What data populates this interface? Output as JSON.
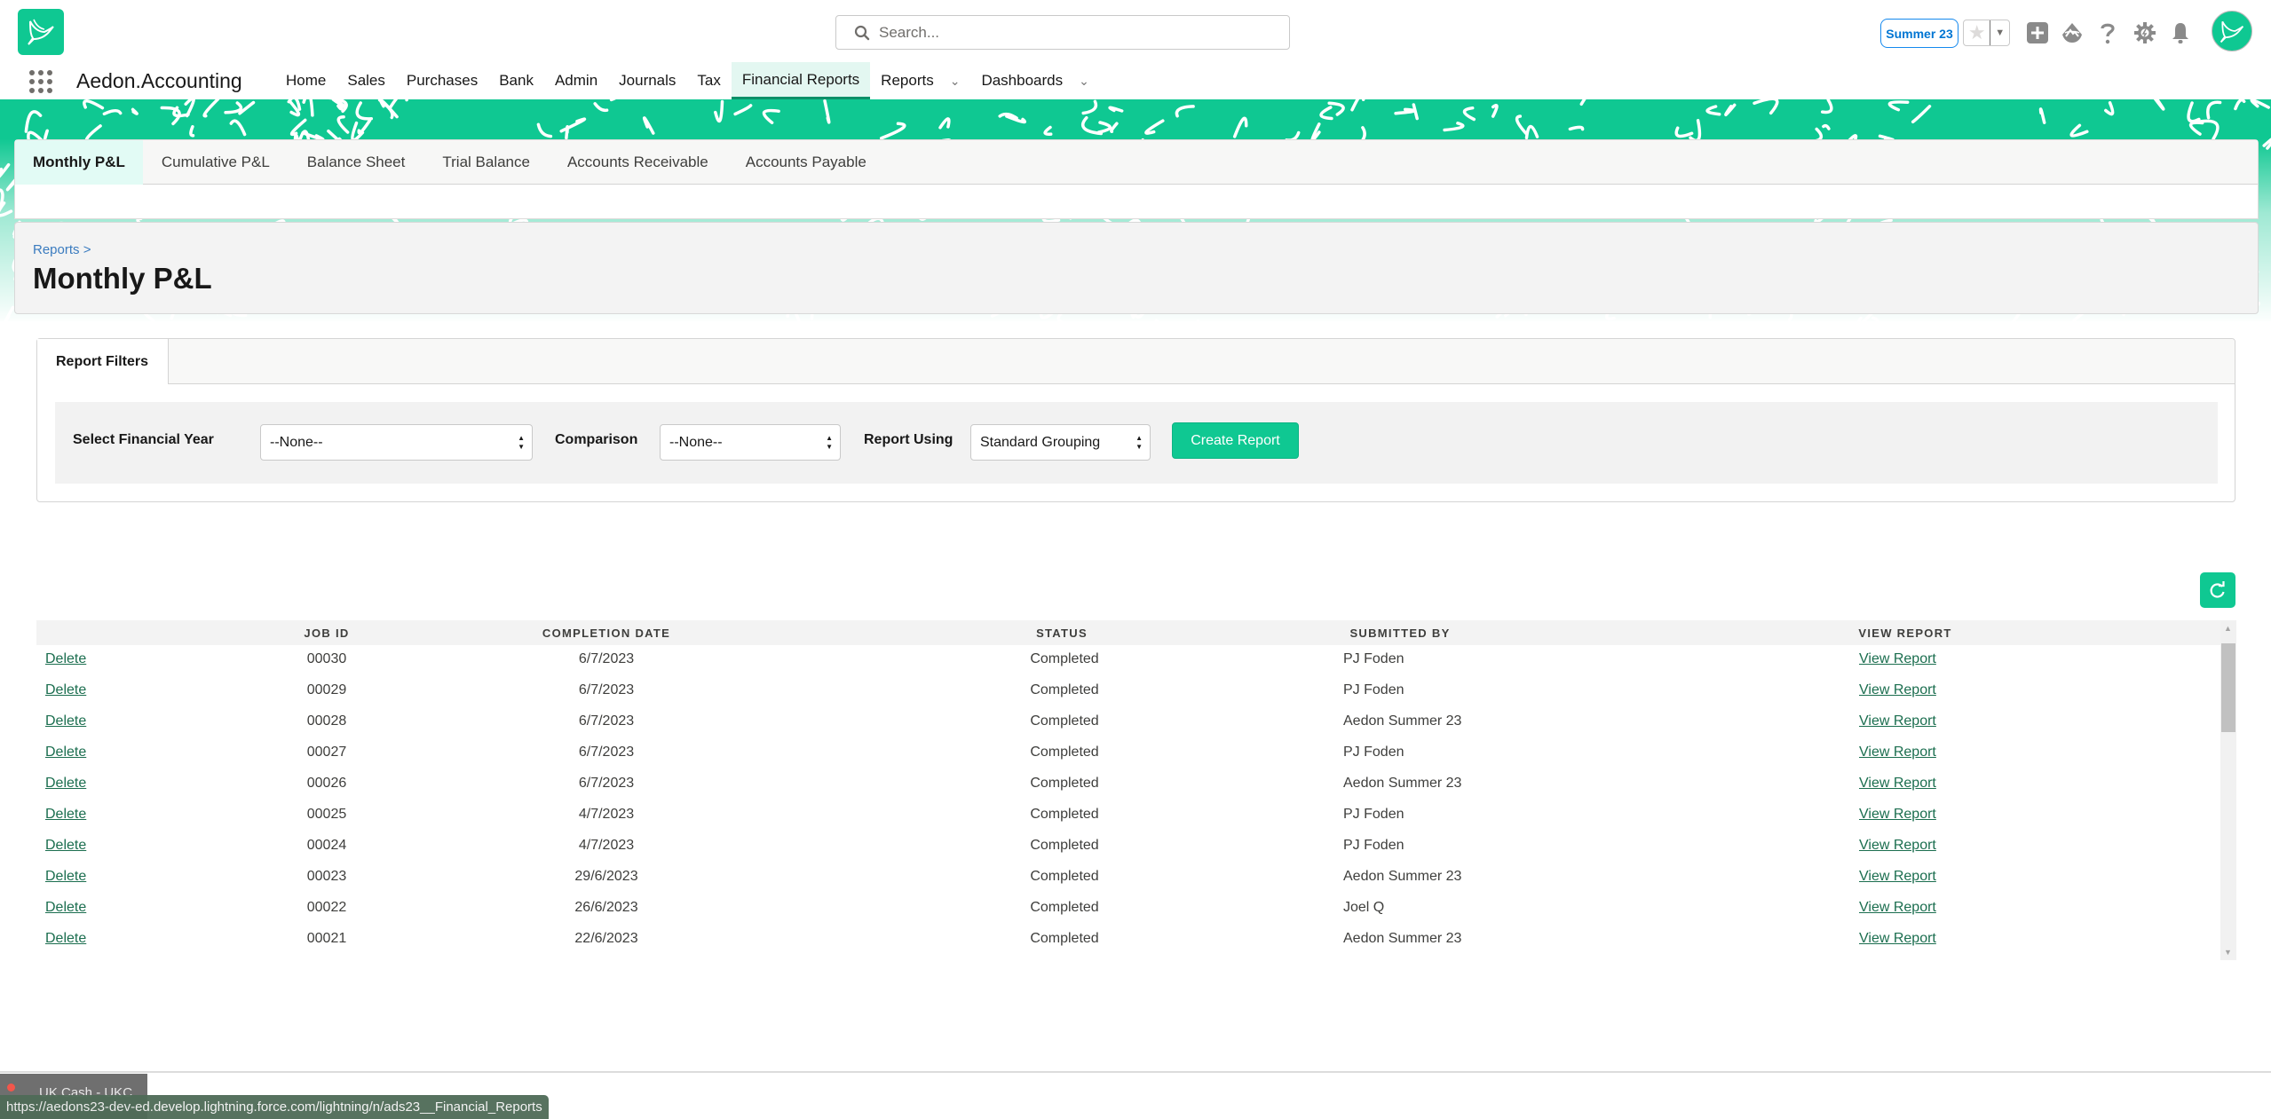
{
  "header": {
    "app_logo_icon": "hummingbird-logo-icon",
    "search_placeholder": "Search...",
    "org_badge": "Summer 23",
    "icons": [
      "favorite-star-icon",
      "favorites-dropdown-icon",
      "global-actions-plus-icon",
      "trailhead-icon",
      "help-icon",
      "setup-gear-icon",
      "notifications-bell-icon",
      "user-avatar-icon"
    ]
  },
  "nav": {
    "app_name": "Aedon.Accounting",
    "items": [
      {
        "label": "Home",
        "active": false,
        "has_menu": false
      },
      {
        "label": "Sales",
        "active": false,
        "has_menu": false
      },
      {
        "label": "Purchases",
        "active": false,
        "has_menu": false
      },
      {
        "label": "Bank",
        "active": false,
        "has_menu": false
      },
      {
        "label": "Admin",
        "active": false,
        "has_menu": false
      },
      {
        "label": "Journals",
        "active": false,
        "has_menu": false
      },
      {
        "label": "Tax",
        "active": false,
        "has_menu": false
      },
      {
        "label": "Financial Reports",
        "active": true,
        "has_menu": false
      },
      {
        "label": "Reports",
        "active": false,
        "has_menu": true
      },
      {
        "label": "Dashboards",
        "active": false,
        "has_menu": true
      }
    ]
  },
  "report_tabs": [
    {
      "label": "Monthly P&L",
      "active": true
    },
    {
      "label": "Cumulative P&L",
      "active": false
    },
    {
      "label": "Balance Sheet",
      "active": false
    },
    {
      "label": "Trial Balance",
      "active": false
    },
    {
      "label": "Accounts Receivable",
      "active": false
    },
    {
      "label": "Accounts Payable",
      "active": false
    }
  ],
  "page": {
    "breadcrumb": "Reports >",
    "title": "Monthly P&L"
  },
  "filters": {
    "tab_label": "Report Filters",
    "financial_year_label": "Select Financial Year",
    "financial_year_value": "--None--",
    "comparison_label": "Comparison",
    "comparison_value": "--None--",
    "report_using_label": "Report Using",
    "report_using_value": "Standard Grouping",
    "create_button": "Create Report"
  },
  "jobs_table": {
    "refresh_icon": "refresh-icon",
    "columns": [
      "",
      "JOB ID",
      "COMPLETION DATE",
      "STATUS",
      "SUBMITTED BY",
      "VIEW REPORT"
    ],
    "rows": [
      {
        "action": "Delete",
        "job_id": "00030",
        "completion_date": "6/7/2023",
        "status": "Completed",
        "submitted_by": "PJ Foden",
        "view": "View Report"
      },
      {
        "action": "Delete",
        "job_id": "00029",
        "completion_date": "6/7/2023",
        "status": "Completed",
        "submitted_by": "PJ Foden",
        "view": "View Report"
      },
      {
        "action": "Delete",
        "job_id": "00028",
        "completion_date": "6/7/2023",
        "status": "Completed",
        "submitted_by": "Aedon Summer 23",
        "view": "View Report"
      },
      {
        "action": "Delete",
        "job_id": "00027",
        "completion_date": "6/7/2023",
        "status": "Completed",
        "submitted_by": "PJ Foden",
        "view": "View Report"
      },
      {
        "action": "Delete",
        "job_id": "00026",
        "completion_date": "6/7/2023",
        "status": "Completed",
        "submitted_by": "Aedon Summer 23",
        "view": "View Report"
      },
      {
        "action": "Delete",
        "job_id": "00025",
        "completion_date": "4/7/2023",
        "status": "Completed",
        "submitted_by": "PJ Foden",
        "view": "View Report"
      },
      {
        "action": "Delete",
        "job_id": "00024",
        "completion_date": "4/7/2023",
        "status": "Completed",
        "submitted_by": "PJ Foden",
        "view": "View Report"
      },
      {
        "action": "Delete",
        "job_id": "00023",
        "completion_date": "29/6/2023",
        "status": "Completed",
        "submitted_by": "Aedon Summer 23",
        "view": "View Report"
      },
      {
        "action": "Delete",
        "job_id": "00022",
        "completion_date": "26/6/2023",
        "status": "Completed",
        "submitted_by": "Joel Q",
        "view": "View Report"
      },
      {
        "action": "Delete",
        "job_id": "00021",
        "completion_date": "22/6/2023",
        "status": "Completed",
        "submitted_by": "Aedon Summer 23",
        "view": "View Report"
      }
    ]
  },
  "footer": {
    "utility_item": "UK Cash - UKC",
    "status_url": "https://aedons23-dev-ed.develop.lightning.force.com/lightning/n/ads23__Financial_Reports"
  },
  "colors": {
    "brand": "#0fc892",
    "link": "#1b6e4f",
    "org_badge": "#0176d3",
    "breadcrumb": "#3a7bbf"
  }
}
